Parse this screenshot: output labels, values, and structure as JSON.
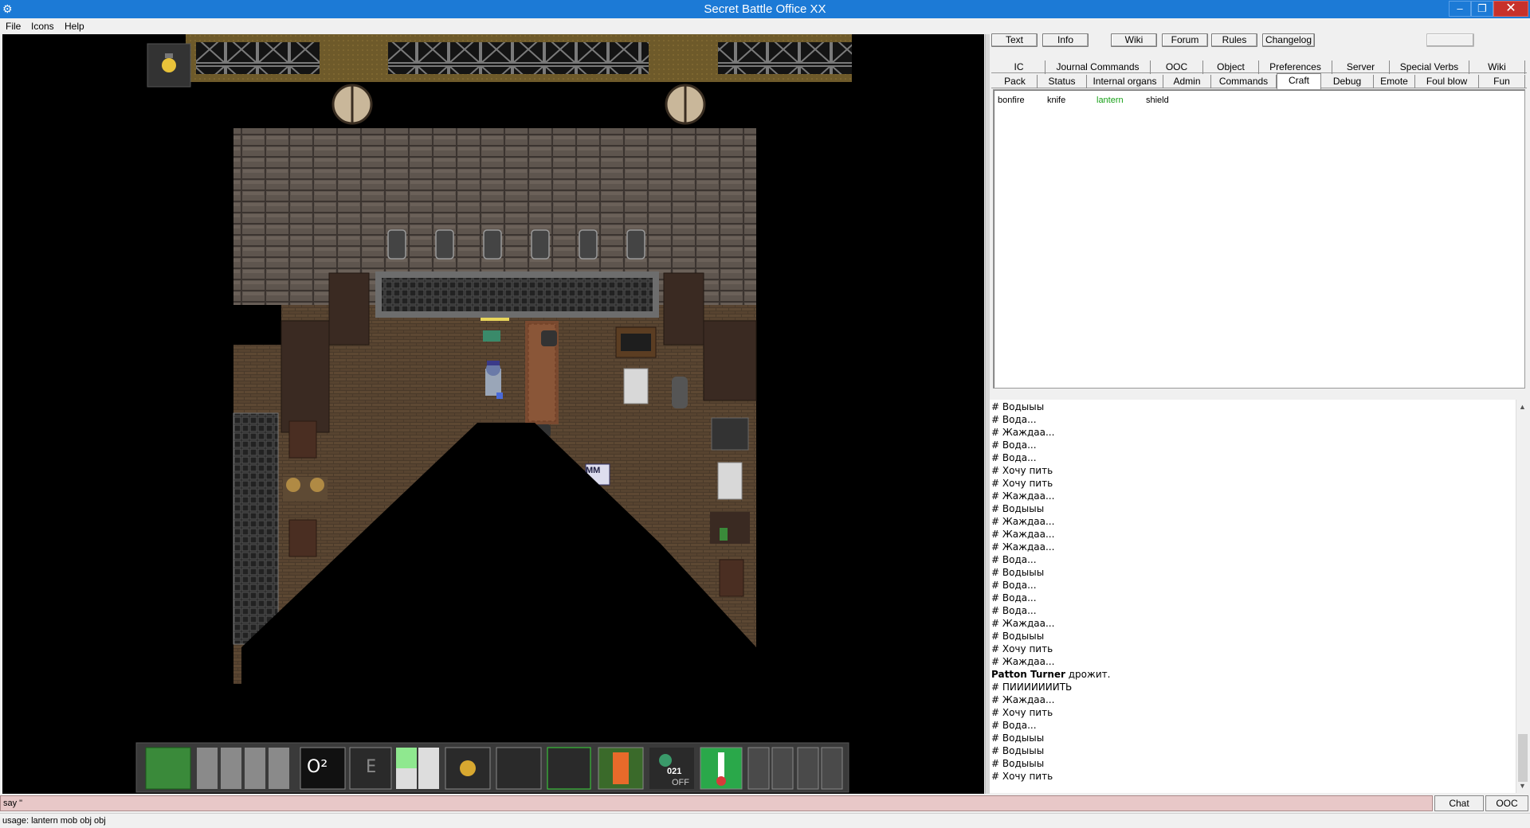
{
  "window": {
    "title": "Secret Battle Office XX",
    "min_glyph": "–",
    "max_glyph": "❐",
    "close_glyph": "✕",
    "app_icon": "gear-icon"
  },
  "menu": [
    "File",
    "Icons",
    "Help"
  ],
  "top_buttons": [
    "Text",
    "Info",
    "Wiki",
    "Forum",
    "Rules",
    "Changelog"
  ],
  "tabs_row1": [
    "IC",
    "Journal Commands",
    "OOC",
    "Object",
    "Preferences",
    "Server",
    "Special Verbs",
    "Wiki"
  ],
  "tabs_row2": [
    "Pack",
    "Status",
    "Internal organs",
    "Admin",
    "Commands",
    "Craft",
    "Debug",
    "Emote",
    "Foul blow",
    "Fun"
  ],
  "objects": [
    {
      "label": "bonfire",
      "highlight": false
    },
    {
      "label": "knife",
      "highlight": false
    },
    {
      "label": "lantern",
      "highlight": true
    },
    {
      "label": "shield",
      "highlight": false
    }
  ],
  "chat": [
    "# Водыыы",
    "# Вода...",
    "# Жаждаа...",
    "# Вода...",
    "# Вода...",
    "# Хочу пить",
    "# Хочу пить",
    "# Жаждаа...",
    "# Водыыы",
    "# Жаждаа...",
    "# Жаждаа...",
    "# Жаждаа...",
    "# Вода...",
    "# Водыыы",
    "# Вода...",
    "# Вода...",
    "# Вода...",
    "# Жаждаа...",
    "# Водыыы",
    "# Хочу пить",
    "# Жаждаа...",
    "__SPEAKER__",
    "# ПИИИИИИИТЬ",
    "# Жаждаа...",
    "# Хочу пить",
    "# Вода...",
    "# Водыыы",
    "# Водыыы",
    "# Водыыы",
    "# Хочу пить"
  ],
  "speaker_line": {
    "name": "Patton Turner",
    "text": " дрожит."
  },
  "input": {
    "value": "say \""
  },
  "side_buttons": {
    "chat": "Chat",
    "ooc": "OOC"
  },
  "status": "usage: lantern mob obj obj",
  "hud": {
    "oxygen_label": "O²",
    "intent_label": "E",
    "temp_status": "OFF",
    "badge_label": "MM",
    "pressure_label": "021"
  }
}
